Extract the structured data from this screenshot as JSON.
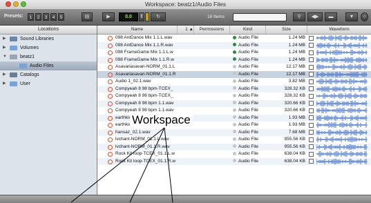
{
  "window": {
    "title": "Workspace: beatz1/Audio Files"
  },
  "toolbar": {
    "presets_label": "Presets:",
    "preset_numbers": [
      "1",
      "2",
      "3",
      "4",
      "5"
    ],
    "lcd_value": "0.0",
    "item_count": "18 Items"
  },
  "sidebar": {
    "header": "Locations",
    "items": [
      {
        "label": "Sound Libraries",
        "indent": 0,
        "expanded": false,
        "icon": "library-icon"
      },
      {
        "label": "Volumes",
        "indent": 0,
        "expanded": false,
        "icon": "folder-icon"
      },
      {
        "label": "beatz1",
        "indent": 0,
        "expanded": true,
        "icon": "workspace-icon"
      },
      {
        "label": "Audio Files",
        "indent": 1,
        "expanded": false,
        "icon": "folder-icon",
        "selected": true
      },
      {
        "label": "Catalogs",
        "indent": 0,
        "expanded": false,
        "icon": "catalog-icon"
      },
      {
        "label": "User",
        "indent": 0,
        "expanded": false,
        "icon": "folder-icon"
      }
    ]
  },
  "columns": {
    "name": "Name",
    "sort_marker": "1 ▲",
    "permissions": "Permissions",
    "kind": "Kind",
    "size": "Size",
    "waveform": "Waveform"
  },
  "files": [
    {
      "name": "098 AntDance Mix 1.1.L.wav",
      "kind": "Audio File",
      "size": "1.24 MB",
      "locked": true
    },
    {
      "name": "098 AntDance Mix 1.1.R.wav",
      "kind": "Audio File",
      "size": "1.24 MB",
      "locked": true
    },
    {
      "name": "098 FrameGame Mix 1.1.L.w",
      "kind": "Audio File",
      "size": "1.24 MB",
      "locked": true
    },
    {
      "name": "098 FrameGame Mix 1.1.R.w",
      "kind": "Audio File",
      "size": "1.24 MB",
      "locked": true
    },
    {
      "name": "Asavariasavari-NORM_01.1.L",
      "kind": "Audio File",
      "size": "12.17 MB",
      "locked": false
    },
    {
      "name": "Asavariasavari-NORM_01.1.R",
      "kind": "Audio File",
      "size": "12.17 MB",
      "locked": false,
      "highlighted": true
    },
    {
      "name": "Audio 1_02.1.wav",
      "kind": "Audio File",
      "size": "3.82 MB",
      "locked": false
    },
    {
      "name": "Compyeah 8 98 bpm-TCEX_",
      "kind": "Audio File",
      "size": "328.32 KB",
      "locked": false
    },
    {
      "name": "Compyeah 8 98 bpm-TCEX_",
      "kind": "Audio File",
      "size": "328.32 KB",
      "locked": false
    },
    {
      "name": "Compyeah 8 98 bpm 1.1.wav",
      "kind": "Audio File",
      "size": "320.66 KB",
      "locked": false
    },
    {
      "name": "Compyeah 8 98 bpm 1.1.wav",
      "kind": "Audio File",
      "size": "320.66 KB",
      "locked": false
    },
    {
      "name": "earthkick-01.1.1.L.wav",
      "kind": "Audio File",
      "size": "1.93 MB",
      "locked": false
    },
    {
      "name": "earthkick-01.1.1.R.wav",
      "kind": "Audio File",
      "size": "1.93 MB",
      "locked": false
    },
    {
      "name": "hansaz_02.1.wav",
      "kind": "Audio File",
      "size": "7.68 MB",
      "locked": false
    },
    {
      "name": "lvchant-NORM_01.1.L.wav",
      "kind": "Audio File",
      "size": "955.56 KB",
      "locked": false
    },
    {
      "name": "lvchant-NORM_01.1.R.wav",
      "kind": "Audio File",
      "size": "955.56 KB",
      "locked": false
    },
    {
      "name": "Rock Kit loop-TCEX_01.1.L.w",
      "kind": "Audio File",
      "size": "638.04 KB",
      "locked": false
    },
    {
      "name": "Rock Kit loop-TCEX_01.1.R.w",
      "kind": "Audio File",
      "size": "638.04 KB",
      "locked": false
    }
  ],
  "annotation": {
    "label": "Workspace"
  },
  "colors": {
    "highlight_row": "#c8d3e2",
    "waveform": "#3f6fc6",
    "locked_kind": "#2e8b3a"
  }
}
